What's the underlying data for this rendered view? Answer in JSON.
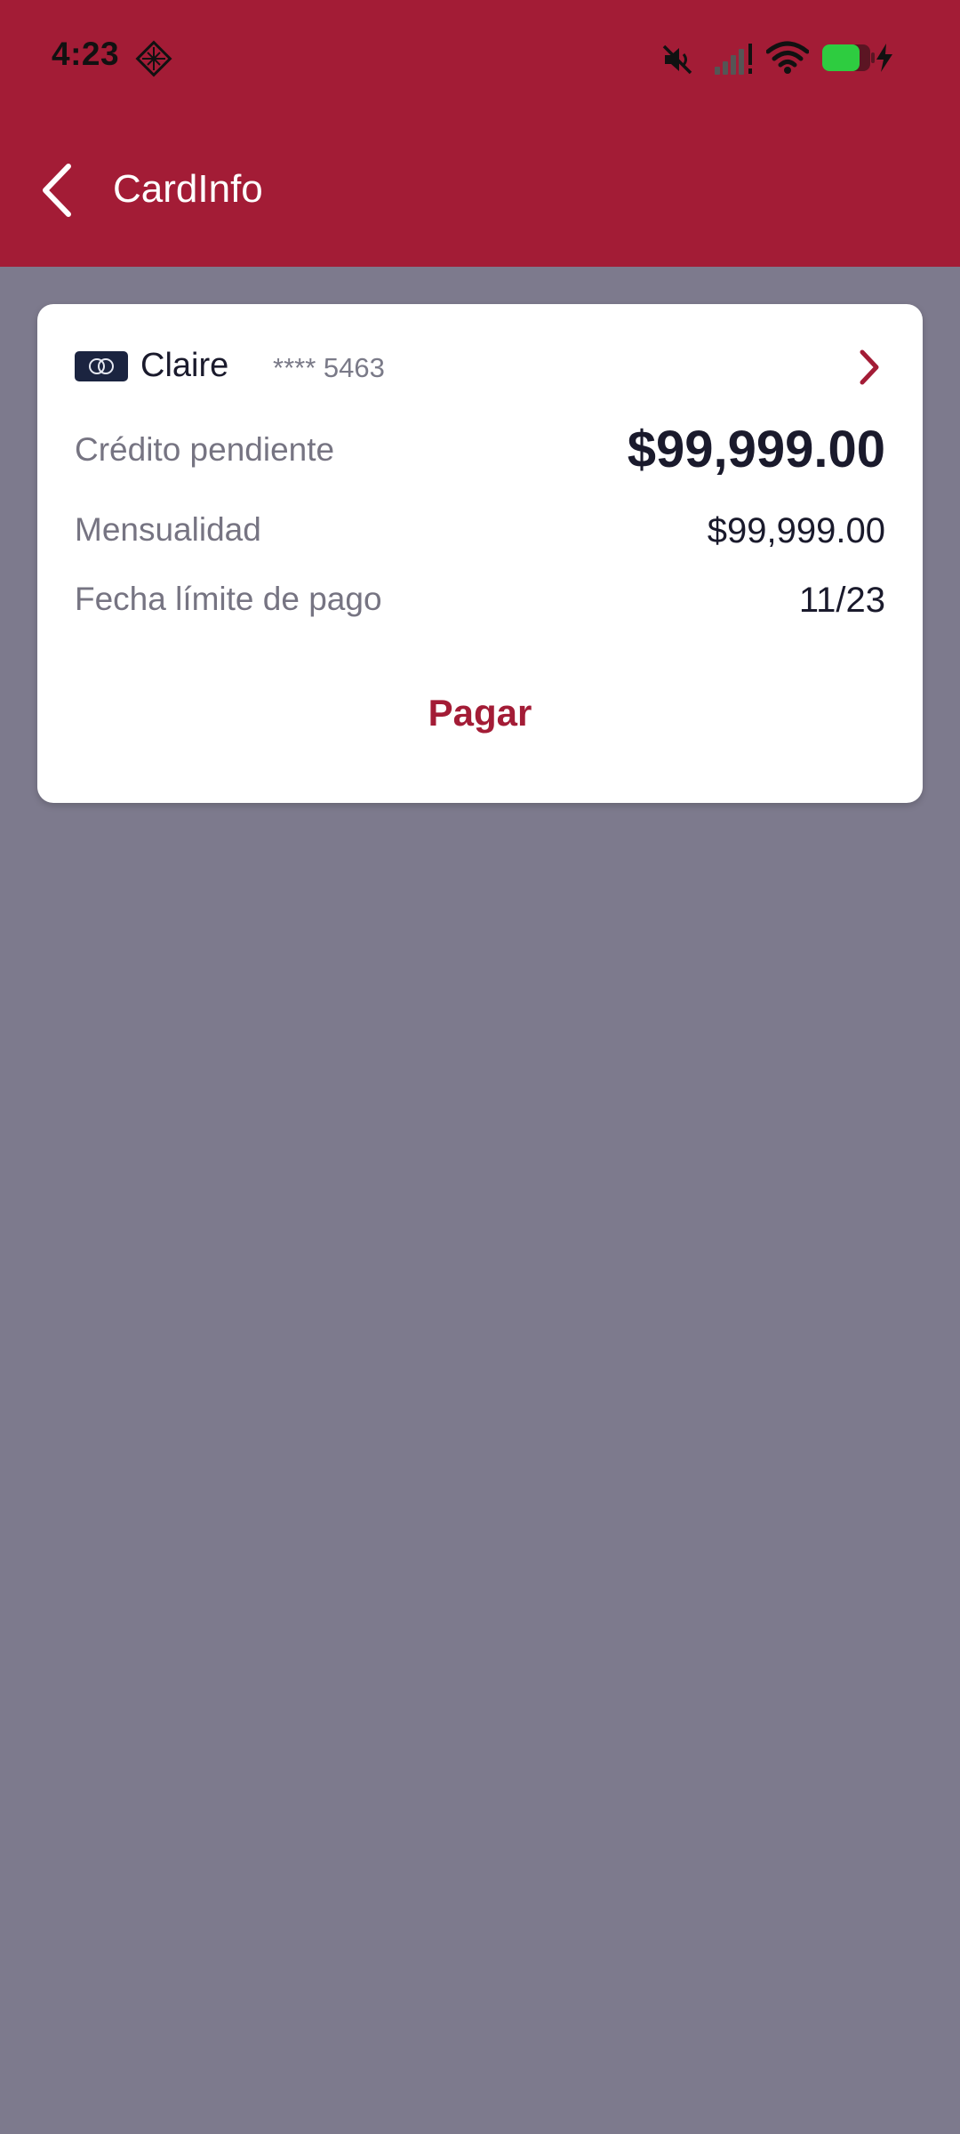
{
  "status_bar": {
    "time": "4:23",
    "battery_color": "#2ecc40"
  },
  "nav": {
    "title": "CardInfo"
  },
  "card": {
    "holder": "Claire",
    "number_masked": "**** 5463",
    "outstanding_credit_label": "Crédito pendiente",
    "outstanding_credit_value": "$99,999.00",
    "monthly_payment_label": "Mensualidad",
    "monthly_payment_value": "$99,999.00",
    "due_date_label": "Fecha límite de pago",
    "due_date_value": "11/23",
    "pay_label": "Pagar"
  },
  "colors": {
    "brand": "#a31c36",
    "background": "#7d7a8d",
    "card": "#ffffff",
    "text_dark": "#1a1a2c",
    "text_muted": "#767482"
  },
  "icons": {
    "status": [
      "grid-notification-icon",
      "mute-icon",
      "signal-icon",
      "wifi-icon",
      "battery-icon",
      "charging-icon"
    ],
    "nav": [
      "back-chevron-icon"
    ],
    "card": [
      "card-brand-logo",
      "chevron-right-icon"
    ]
  }
}
